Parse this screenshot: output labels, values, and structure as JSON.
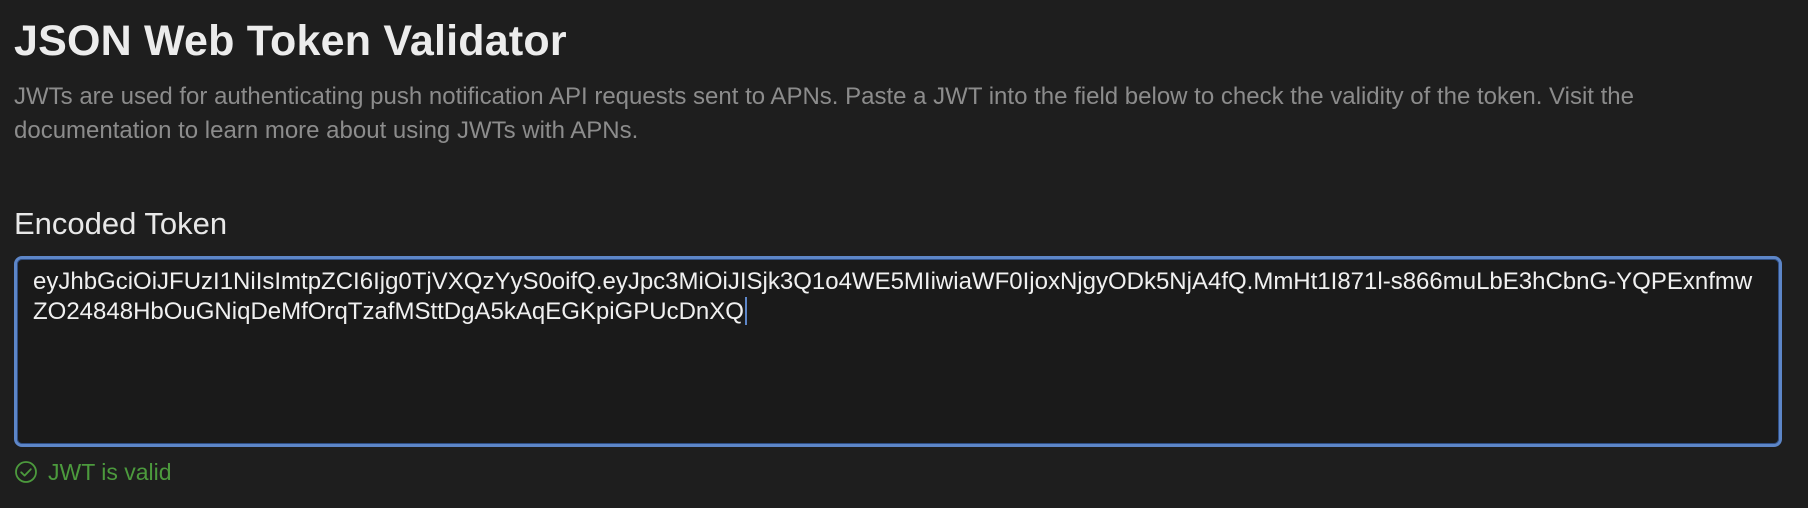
{
  "page": {
    "title": "JSON Web Token Validator",
    "description": "JWTs are used for authenticating push notification API requests sent to APNs. Paste a JWT into the field below to check the validity of the token. Visit the documentation to learn more about using JWTs with APNs."
  },
  "token_section": {
    "heading": "Encoded Token",
    "value": "eyJhbGciOiJFUzI1NiIsImtpZCI6Ijg0TjVXQzYyS0oifQ.eyJpc3MiOiJISjk3Q1o4WE5MIiwiaWF0IjoxNjgyODk5NjA4fQ.MmHt1I871l-s866muLbE3hCbnG-YQPExnfmwZO24848HbOuGNiqDeMfOrqTzafMSttDgA5kAqEGKpiGPUcDnXQ"
  },
  "status": {
    "text": "JWT is valid",
    "icon": "checkmark-circle-icon",
    "color": "#4c9a3d"
  },
  "colors": {
    "background": "#1e1e1e",
    "accent": "#5d86c8",
    "muted_text": "#8c8c8c"
  }
}
